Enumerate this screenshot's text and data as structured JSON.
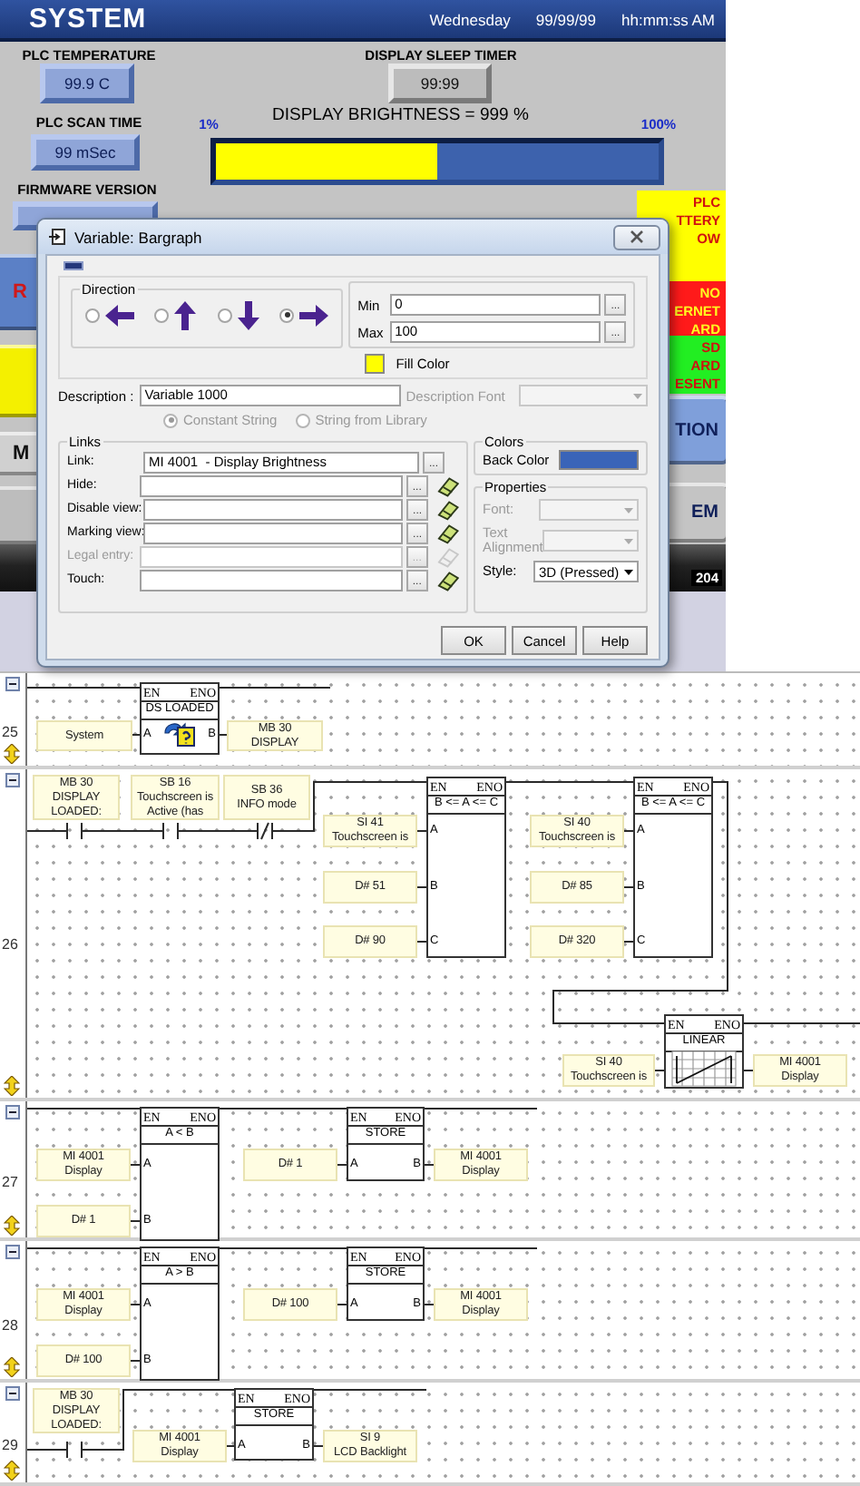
{
  "hmi": {
    "header": {
      "title": "SYSTEM",
      "day": "Wednesday",
      "date": "99/99/99",
      "time": "hh:mm:ss AM"
    },
    "plc_temperature": {
      "label": "PLC TEMPERATURE",
      "value": "99.9 C"
    },
    "plc_scan_time": {
      "label": "PLC SCAN TIME",
      "value": "99 mSec"
    },
    "firmware_version": {
      "label": "FIRMWARE VERSION"
    },
    "display_sleep_timer": {
      "label": "DISPLAY SLEEP TIMER",
      "value": "99:99"
    },
    "brightness": {
      "label": "DISPLAY BRIGHTNESS = 999 %",
      "min_label": "1%",
      "max_label": "100%",
      "level": 0.5
    },
    "status_tiles": [
      {
        "text": "PLC\nTTERY\nOW",
        "color": "#ffff00"
      },
      {
        "text": "NO\nERNET\nARD",
        "color": "#ff1a1a"
      },
      {
        "text": "SD\nARD\nESENT",
        "color": "#22ee22"
      }
    ],
    "left_buttons": [
      {
        "text": "R",
        "color": "#5b80c6"
      },
      {
        "color": "#f4f000"
      },
      {
        "text": "M",
        "color": "#d0d0d0"
      }
    ],
    "right_buttons": [
      {
        "text": "TION",
        "color": "#7f9fda"
      },
      {
        "text": "EM",
        "color": "#c4c4c4"
      }
    ],
    "bottom_bar": {
      "text": "204"
    }
  },
  "dialog": {
    "title": "Variable: Bargraph",
    "direction": {
      "label": "Direction",
      "options": [
        {
          "kind": "left",
          "selected": false
        },
        {
          "kind": "up",
          "selected": false
        },
        {
          "kind": "down",
          "selected": false
        },
        {
          "kind": "right",
          "selected": true
        }
      ]
    },
    "range": [
      {
        "label": "Min",
        "value": "0",
        "browse": "..."
      },
      {
        "label": "Max",
        "value": "100",
        "browse": "..."
      }
    ],
    "fill_color": {
      "label": "Fill Color",
      "color": "#ffff00"
    },
    "description": {
      "label": "Description :",
      "value": "Variable 1000"
    },
    "description_font": {
      "label": "Description Font",
      "disabled": true
    },
    "string_source": [
      {
        "label": "Constant String",
        "selected": true,
        "disabled": true
      },
      {
        "label": "String from Library",
        "selected": false,
        "disabled": true
      }
    ],
    "links": {
      "label": "Links",
      "rows": [
        {
          "kind": "link",
          "label": "Link:",
          "value": "MI 4001  - Display Brightness",
          "browse": "...",
          "disabled": false
        },
        {
          "kind": "view",
          "label": "Hide:",
          "browse": "...",
          "disabled": false
        },
        {
          "kind": "view",
          "label": "Disable view:",
          "browse": "...",
          "disabled": false
        },
        {
          "kind": "view",
          "label": "Marking view:",
          "browse": "...",
          "disabled": false
        },
        {
          "kind": "view",
          "label": "Legal entry:",
          "browse": "...",
          "disabled": true
        },
        {
          "kind": "view",
          "label": "Touch:",
          "browse": "...",
          "disabled": false
        }
      ]
    },
    "colors": {
      "label": "Colors",
      "back_color": {
        "label": "Back Color",
        "color": "#3a64b8"
      }
    },
    "properties": {
      "label": "Properties",
      "font": {
        "label": "Font:",
        "disabled": true
      },
      "text_alignment": {
        "label": "Text\nAlignment",
        "disabled": true
      },
      "style": {
        "label": "Style:",
        "value": "3D (Pressed)",
        "disabled": false
      }
    },
    "buttons": [
      "OK",
      "Cancel",
      "Help"
    ]
  },
  "ladder": {
    "rungs": [
      {
        "number": "25",
        "elements": [
          {
            "kind": "operand",
            "text": "System"
          },
          {
            "kind": "block",
            "en": "EN",
            "eno": "ENO",
            "title": "DS LOADED",
            "inputs": [
              "A"
            ],
            "outputs": [
              "B"
            ]
          },
          {
            "kind": "operand",
            "text": "MB 30\nDISPLAY"
          }
        ]
      },
      {
        "number": "26",
        "elements": [
          {
            "kind": "operand",
            "text": "MB 30\nDISPLAY\nLOADED:"
          },
          {
            "kind": "operand",
            "text": "SB 16\nTouchscreen is\nActive (has"
          },
          {
            "kind": "operand",
            "text": "SB 36\nINFO mode"
          },
          {
            "kind": "contact",
            "negated": false
          },
          {
            "kind": "contact",
            "negated": false
          },
          {
            "kind": "contact",
            "negated": true
          },
          {
            "kind": "operand",
            "text": "SI 41\nTouchscreen is"
          },
          {
            "kind": "operand",
            "text": "D# 51"
          },
          {
            "kind": "operand",
            "text": "D# 90"
          },
          {
            "kind": "block",
            "en": "EN",
            "eno": "ENO",
            "title": "B <= A <= C",
            "inputs": [
              "A",
              "B",
              "C"
            ]
          },
          {
            "kind": "operand",
            "text": "SI 40\nTouchscreen is"
          },
          {
            "kind": "operand",
            "text": "D# 85"
          },
          {
            "kind": "operand",
            "text": "D# 320"
          },
          {
            "kind": "block",
            "en": "EN",
            "eno": "ENO",
            "title": "B <= A <= C",
            "inputs": [
              "A",
              "B",
              "C"
            ]
          },
          {
            "kind": "operand",
            "text": "SI 40\nTouchscreen is"
          },
          {
            "kind": "block",
            "en": "EN",
            "eno": "ENO",
            "title": "LINEAR"
          },
          {
            "kind": "operand",
            "text": "MI 4001\nDisplay"
          }
        ]
      },
      {
        "number": "27",
        "elements": [
          {
            "kind": "operand",
            "text": "MI 4001\nDisplay"
          },
          {
            "kind": "operand",
            "text": "D# 1"
          },
          {
            "kind": "block",
            "en": "EN",
            "eno": "ENO",
            "title": "A < B",
            "inputs": [
              "A",
              "B"
            ]
          },
          {
            "kind": "operand",
            "text": "D# 1"
          },
          {
            "kind": "block",
            "en": "EN",
            "eno": "ENO",
            "title": "STORE",
            "inputs": [
              "A"
            ],
            "outputs": [
              "B"
            ]
          },
          {
            "kind": "operand",
            "text": "MI 4001\nDisplay"
          }
        ]
      },
      {
        "number": "28",
        "elements": [
          {
            "kind": "operand",
            "text": "MI 4001\nDisplay"
          },
          {
            "kind": "operand",
            "text": "D# 100"
          },
          {
            "kind": "block",
            "en": "EN",
            "eno": "ENO",
            "title": "A > B",
            "inputs": [
              "A",
              "B"
            ]
          },
          {
            "kind": "operand",
            "text": "D# 100"
          },
          {
            "kind": "block",
            "en": "EN",
            "eno": "ENO",
            "title": "STORE",
            "inputs": [
              "A"
            ],
            "outputs": [
              "B"
            ]
          },
          {
            "kind": "operand",
            "text": "MI 4001\nDisplay"
          }
        ]
      },
      {
        "number": "29",
        "elements": [
          {
            "kind": "operand",
            "text": "MB 30\nDISPLAY\nLOADED:"
          },
          {
            "kind": "contact",
            "negated": false
          },
          {
            "kind": "operand",
            "text": "MI 4001\nDisplay"
          },
          {
            "kind": "block",
            "en": "EN",
            "eno": "ENO",
            "title": "STORE",
            "inputs": [
              "A"
            ],
            "outputs": [
              "B"
            ]
          },
          {
            "kind": "operand",
            "text": "SI 9\nLCD Backlight"
          }
        ]
      }
    ]
  }
}
